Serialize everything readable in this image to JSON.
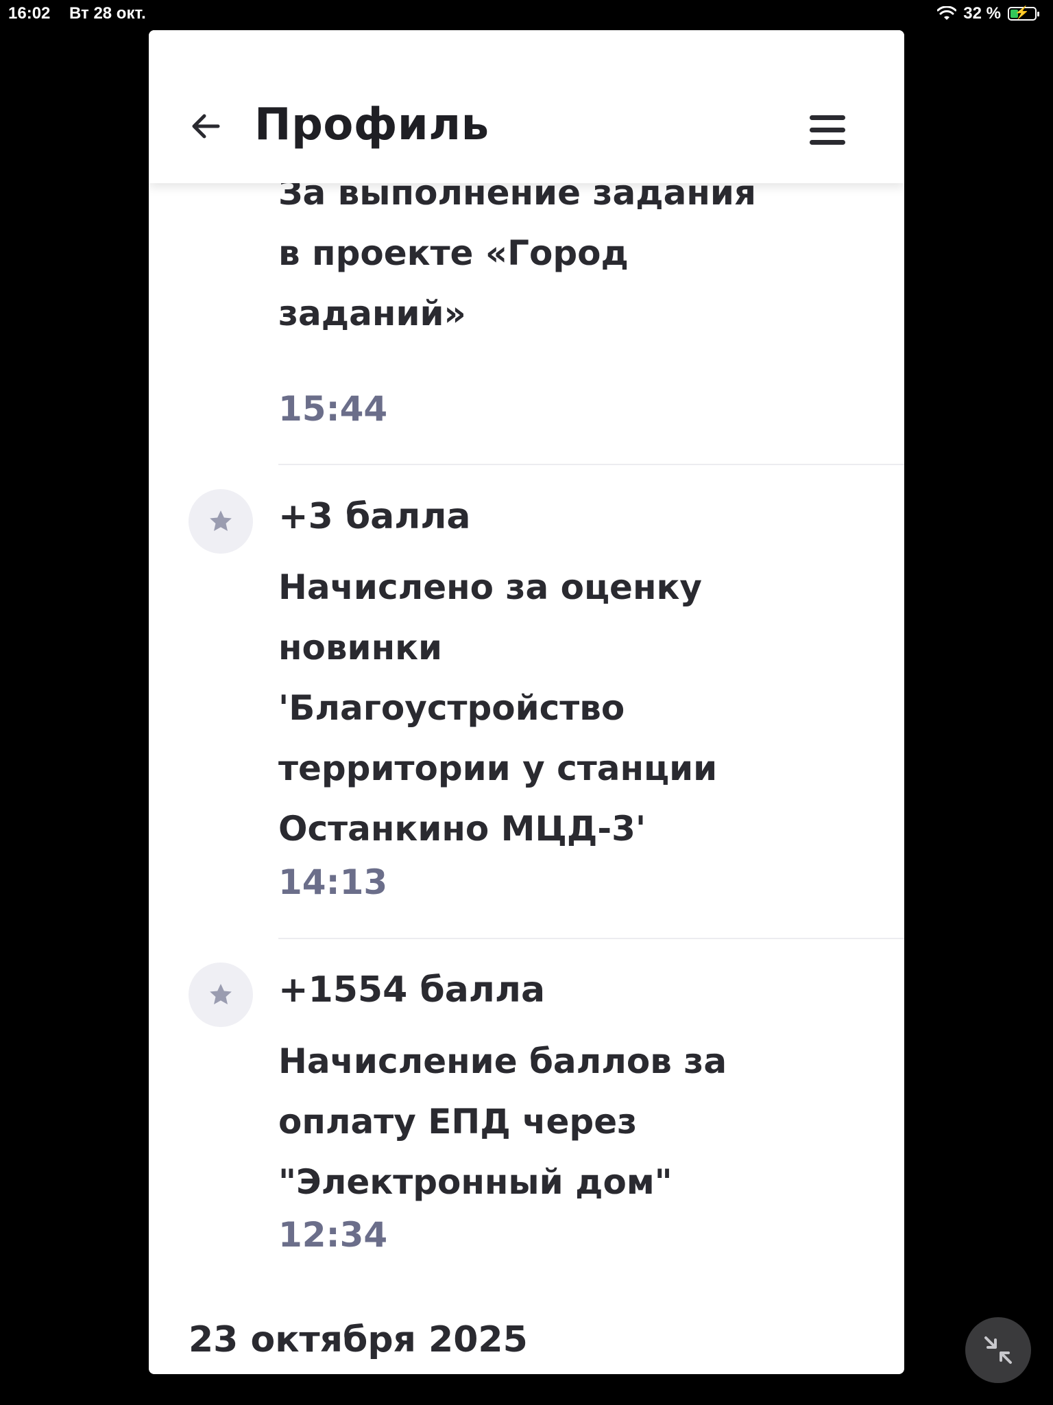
{
  "status_bar": {
    "time": "16:02",
    "date": "Вт 28 окт.",
    "battery": "32 %",
    "battery_level": 0.32
  },
  "header": {
    "title": "Профиль"
  },
  "entries": [
    {
      "description_lines": [
        "За выполнение задания",
        "в проекте «Город",
        "заданий»"
      ],
      "time": "15:44"
    },
    {
      "points": "+3 балла",
      "description_lines": [
        "Начислено за оценку",
        "новинки",
        "'Благоустройство",
        "территории у станции",
        "Останкино МЦД-3'"
      ],
      "time": "14:13"
    },
    {
      "points": "+1554 балла",
      "description_lines": [
        "Начисление баллов за",
        "оплату ЕПД через",
        "\"Электронный дом\""
      ],
      "time": "12:34"
    }
  ],
  "date_heading": "23 октября 2025",
  "colors": {
    "accent_time": "#6b6e8a",
    "text": "#2a2a30",
    "star_bg": "#efeff4",
    "star": "#9a9cb0"
  }
}
